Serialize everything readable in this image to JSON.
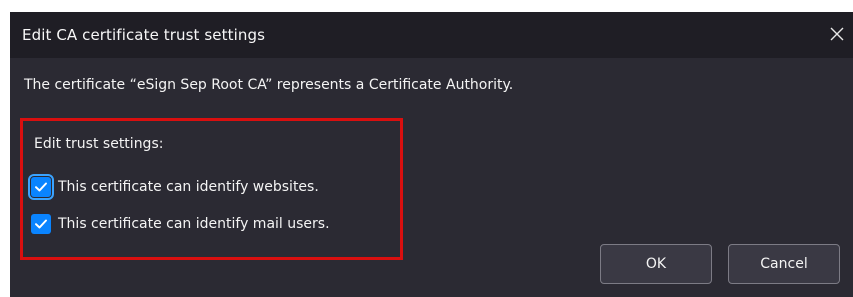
{
  "dialog": {
    "title": "Edit CA certificate trust settings",
    "close_glyph": "close-icon",
    "description": "The certificate “eSign Sep Root CA” represents a Certificate Authority.",
    "trust_group": {
      "label": "Edit trust settings:",
      "options": [
        {
          "label": "This certificate can identify websites.",
          "checked": true
        },
        {
          "label": "This certificate can identify mail users.",
          "checked": true
        }
      ]
    },
    "buttons": {
      "ok": "OK",
      "cancel": "Cancel"
    }
  },
  "colors": {
    "dialog_bg": "#2b2a33",
    "title_bar_bg": "#1f1e25",
    "accent": "#0a84ff",
    "highlight_border": "#d90f0f",
    "text": "#f4f4f4"
  }
}
